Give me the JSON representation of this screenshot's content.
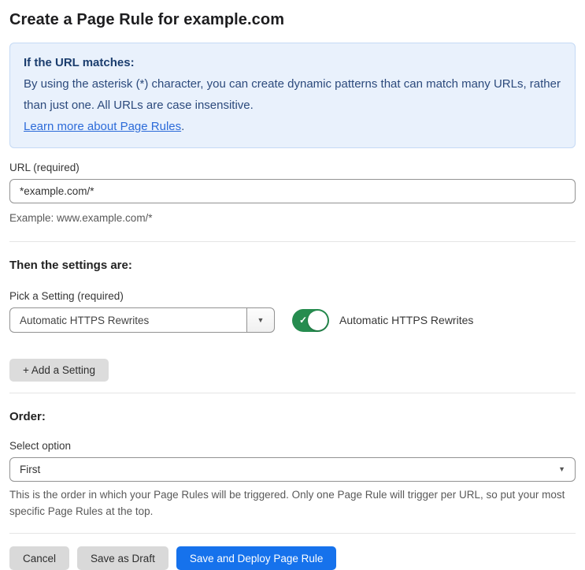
{
  "page": {
    "title": "Create a Page Rule for example.com"
  },
  "info_box": {
    "heading": "If the URL matches:",
    "body": "By using the asterisk (*) character, you can create dynamic patterns that can match many URLs, rather than just one. All URLs are case insensitive.",
    "link_label": "Learn more about Page Rules",
    "link_suffix": "."
  },
  "url_field": {
    "label": "URL (required)",
    "value": "*example.com/*",
    "helper": "Example: www.example.com/*"
  },
  "settings_section": {
    "heading": "Then the settings are:",
    "picker_label": "Pick a Setting (required)",
    "picker_value": "Automatic HTTPS Rewrites",
    "toggle_label": "Automatic HTTPS Rewrites",
    "toggle_state": "on",
    "add_setting_button": "+ Add a Setting"
  },
  "order_section": {
    "heading": "Order:",
    "select_label": "Select option",
    "select_value": "First",
    "helper": "This is the order in which your Page Rules will be triggered. Only one Page Rule will trigger per URL, so put your most specific Page Rules at the top."
  },
  "footer": {
    "cancel_label": "Cancel",
    "save_draft_label": "Save as Draft",
    "save_deploy_label": "Save and Deploy Page Rule"
  },
  "icons": {
    "dropdown_arrow": "▼",
    "check": "✓"
  },
  "colors": {
    "accent_blue": "#1672ec",
    "toggle_green": "#268c4f",
    "info_box_bg": "#e9f1fc",
    "info_box_border": "#c5daf5",
    "info_text": "#2c4a7c",
    "link_blue": "#2c6bd9",
    "button_gray": "#d9d9d9"
  }
}
